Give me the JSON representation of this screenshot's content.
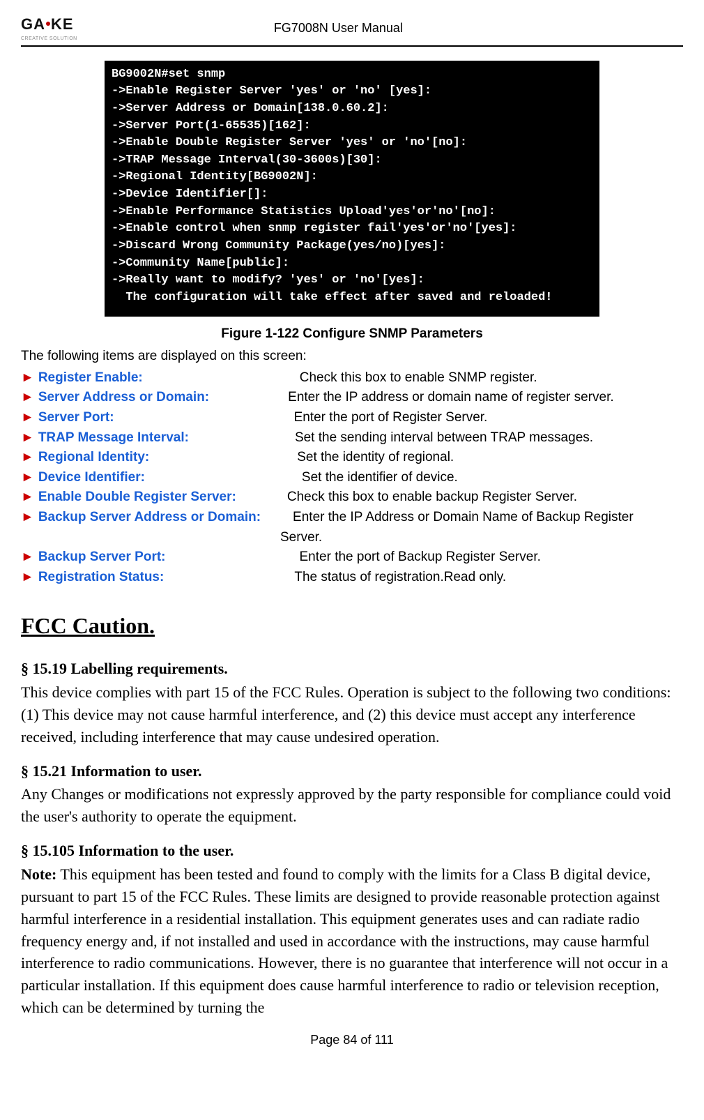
{
  "header": {
    "logo_brand": "GAOKE",
    "logo_sub": "CREATIVE SOLUTION",
    "doc_title": "FG7008N User Manual"
  },
  "terminal_lines": [
    "BG9002N#set snmp",
    "->Enable Register Server 'yes' or 'no' [yes]:",
    "->Server Address or Domain[138.0.60.2]:",
    "->Server Port(1-65535)[162]:",
    "->Enable Double Register Server 'yes' or 'no'[no]:",
    "->TRAP Message Interval(30-3600s)[30]:",
    "->Regional Identity[BG9002N]:",
    "->Device Identifier[]:",
    "->Enable Performance Statistics Upload'yes'or'no'[no]:",
    "->Enable control when snmp register fail'yes'or'no'[yes]:",
    "->Discard Wrong Community Package(yes/no)[yes]:",
    "->Community Name[public]:",
    "->Really want to modify? 'yes' or 'no'[yes]:",
    "  The configuration will take effect after saved and reloaded!"
  ],
  "figure_caption": "Figure 1-122 Configure SNMP Parameters",
  "intro_line": "The following items are displayed on this screen:",
  "params": [
    {
      "label": "Register Enable:",
      "gap": 225,
      "desc": "Check this box to enable SNMP register."
    },
    {
      "label": "Server Address or Domain:",
      "gap": 113,
      "desc": "Enter the IP address or domain name of register server."
    },
    {
      "label": "Server Port:",
      "gap": 258,
      "desc": "Enter the port of Register Server."
    },
    {
      "label": "TRAP Message Interval:",
      "gap": 152,
      "desc": "Set the sending interval between TRAP messages."
    },
    {
      "label": "Regional Identity:",
      "gap": 212,
      "desc": "Set the identity of regional."
    },
    {
      "label": "Device Identifier:",
      "gap": 225,
      "desc": "Set the identifier of device."
    },
    {
      "label": "Enable Double Register Server:",
      "gap": 73,
      "desc": "Check this box to enable backup Register Server."
    },
    {
      "label": "Backup Server Address or Domain:",
      "gap": 46,
      "desc": "Enter the IP Address or Domain Name of Backup Register"
    },
    {
      "label": "",
      "gap": 0,
      "desc": "Server.",
      "continuation": true
    },
    {
      "label": "Backup Server Port:",
      "gap": 192,
      "desc": "Enter the port of Backup Register Server."
    },
    {
      "label": "Registration Status:",
      "gap": 187,
      "desc": "The status of registration.Read only."
    }
  ],
  "fcc_heading": "FCC Caution.",
  "sections": [
    {
      "heading": "§ 15.19 Labelling requirements.",
      "body": "This device complies with part 15 of the FCC Rules. Operation is subject to the following two conditions: (1) This device may not cause harmful interference, and (2) this device must accept any interference received, including interference that may cause undesired operation."
    },
    {
      "heading": "§ 15.21 Information to user.",
      "body": "Any Changes or modifications not expressly approved by the party responsible for compliance could void the user's authority to operate the equipment."
    },
    {
      "heading": "§ 15.105 Information to the user.",
      "note_label": "Note:",
      "body": " This equipment has been tested and found to comply with the limits for a Class B digital device, pursuant to part 15 of the FCC Rules. These limits are designed to provide reasonable protection against harmful interference in a residential installation. This equipment generates uses and can radiate radio frequency energy and, if not installed and used in accordance with the instructions, may cause harmful interference to radio communications. However, there is no guarantee that interference will not occur in a particular installation. If this equipment does cause harmful interference to radio or television reception, which can be determined by turning the"
    }
  ],
  "footer": "Page 84 of 111"
}
